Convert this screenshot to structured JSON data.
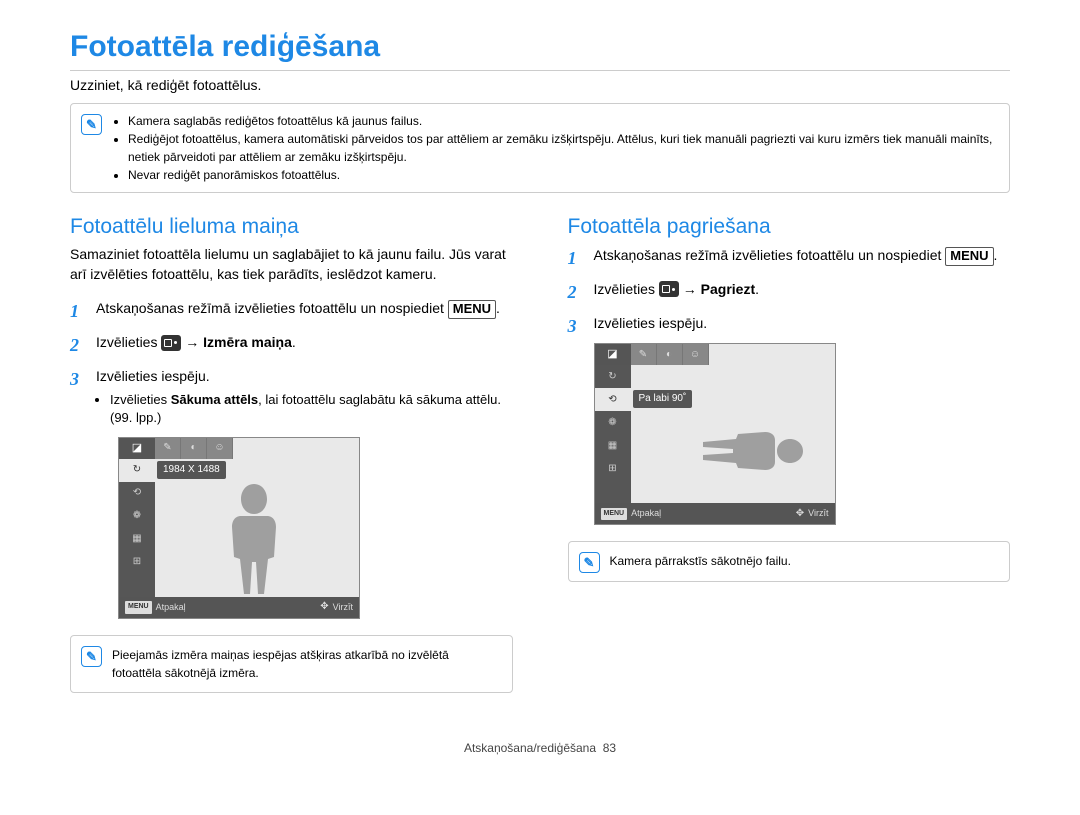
{
  "title": "Fotoattēla rediģēšana",
  "intro": "Uzziniet, kā rediģēt fotoattēlus.",
  "top_info": [
    "Kamera saglabās rediģētos fotoattēlus kā jaunus failus.",
    "Rediģējot fotoattēlus, kamera automātiski pārveidos tos par attēliem ar zemāku izšķirtspēju. Attēlus, kuri tiek manuāli pagriezti vai kuru izmērs tiek manuāli mainīts, netiek pārveidoti par attēliem ar zemāku izšķirtspēju.",
    "Nevar rediģēt panorāmiskos fotoattēlus."
  ],
  "left": {
    "title": "Fotoattēlu lieluma maiņa",
    "desc": "Samaziniet fotoattēla lielumu un saglabājiet to kā jaunu failu. Jūs varat arī izvēlēties fotoattēlu, kas tiek parādīts, ieslēdzot kameru.",
    "step1_a": "Atskaņošanas režīmā izvēlieties fotoattēlu un nospiediet ",
    "menu": "MENU",
    "period": ".",
    "step2_a": "Izvēlieties ",
    "step2_b": " → ",
    "step2_c": "Izmēra maiņa",
    "step3": "Izvēlieties iespēju.",
    "bullet_a": "Izvēlieties ",
    "bullet_b": "Sākuma attēls",
    "bullet_c": ", lai fotoattēlu saglabātu kā sākuma attēlu. (99. lpp.)",
    "ss_label": "1984 X 1488",
    "ss_back": "Atpakaļ",
    "ss_move": "Virzīt",
    "info_note": "Pieejamās izmēra maiņas iespējas atšķiras atkarībā no izvēlētā fotoattēla sākotnējā izmēra."
  },
  "right": {
    "title": "Fotoattēla pagriešana",
    "step1_a": "Atskaņošanas režīmā izvēlieties fotoattēlu un nospiediet ",
    "menu": "MENU",
    "period": ".",
    "step2_a": "Izvēlieties ",
    "step2_b": " → ",
    "step2_c": "Pagriezt",
    "step3": "Izvēlieties iespēju.",
    "ss_label": "Pa labi 90˚",
    "ss_back": "Atpakaļ",
    "ss_move": "Virzīt",
    "info_note": "Kamera pārrakstīs sākotnējo failu."
  },
  "footer": {
    "section": "Atskaņošana/rediģēšana",
    "page": "83"
  }
}
